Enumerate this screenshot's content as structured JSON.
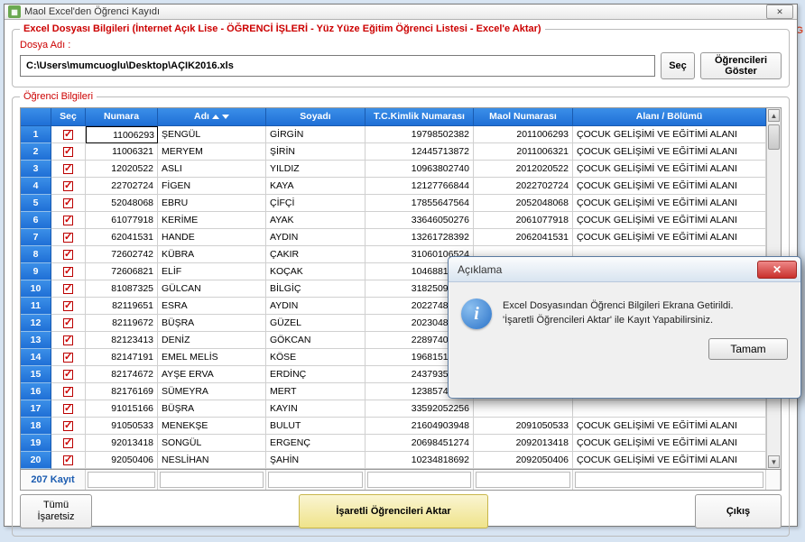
{
  "bg_text": "ESLEKİ EĞİTİM PROG",
  "window": {
    "title": "Maol Excel'den Öğrenci Kayıdı",
    "close_glyph": "✕"
  },
  "fileinfo": {
    "legend": "Excel Dosyası Bilgileri (İnternet Açık Lise - ÖĞRENCİ İŞLERİ - Yüz Yüze Eğitim Öğrenci Listesi - Excel'e Aktar)",
    "file_label": "Dosya Adı :",
    "path": "C:\\Users\\mumcuoglu\\Desktop\\AÇIK2016.xls",
    "sec_label": "Seç",
    "show_label": "Öğrencileri Göster"
  },
  "gridinfo": {
    "legend": "Öğrenci Bilgileri",
    "count_label": "207 Kayıt"
  },
  "columns": {
    "sec": "Seç",
    "numara": "Numara",
    "adi": "Adı",
    "soyadi": "Soyadı",
    "tc": "T.C.Kimlik Numarası",
    "maol": "Maol Numarası",
    "alan": "Alanı / Bölümü"
  },
  "rows": [
    {
      "idx": "1",
      "numara": "11006293",
      "adi": "ŞENGÜL",
      "soyadi": "GİRGİN",
      "tc": "19798502382",
      "maol": "2011006293",
      "alan": "ÇOCUK GELİŞİMİ VE EĞİTİMİ ALANI"
    },
    {
      "idx": "2",
      "numara": "11006321",
      "adi": "MERYEM",
      "soyadi": "ŞİRİN",
      "tc": "12445713872",
      "maol": "2011006321",
      "alan": "ÇOCUK GELİŞİMİ VE EĞİTİMİ ALANI"
    },
    {
      "idx": "3",
      "numara": "12020522",
      "adi": "ASLI",
      "soyadi": "YILDIZ",
      "tc": "10963802740",
      "maol": "2012020522",
      "alan": "ÇOCUK GELİŞİMİ VE EĞİTİMİ ALANI"
    },
    {
      "idx": "4",
      "numara": "22702724",
      "adi": "FİGEN",
      "soyadi": "KAYA",
      "tc": "12127766844",
      "maol": "2022702724",
      "alan": "ÇOCUK GELİŞİMİ VE EĞİTİMİ ALANI"
    },
    {
      "idx": "5",
      "numara": "52048068",
      "adi": "EBRU",
      "soyadi": "ÇİFÇİ",
      "tc": "17855647564",
      "maol": "2052048068",
      "alan": "ÇOCUK GELİŞİMİ VE EĞİTİMİ ALANI"
    },
    {
      "idx": "6",
      "numara": "61077918",
      "adi": "KERİME",
      "soyadi": "AYAK",
      "tc": "33646050276",
      "maol": "2061077918",
      "alan": "ÇOCUK GELİŞİMİ VE EĞİTİMİ ALANI"
    },
    {
      "idx": "7",
      "numara": "62041531",
      "adi": "HANDE",
      "soyadi": "AYDIN",
      "tc": "13261728392",
      "maol": "2062041531",
      "alan": "ÇOCUK GELİŞİMİ VE EĞİTİMİ ALANI"
    },
    {
      "idx": "8",
      "numara": "72602742",
      "adi": "KÜBRA",
      "soyadi": "ÇAKIR",
      "tc": "31060106524",
      "maol": "",
      "alan": ""
    },
    {
      "idx": "9",
      "numara": "72606821",
      "adi": "ELİF",
      "soyadi": "KOÇAK",
      "tc": "10468810806",
      "maol": "",
      "alan": ""
    },
    {
      "idx": "10",
      "numara": "81087325",
      "adi": "GÜLCAN",
      "soyadi": "BİLGİÇ",
      "tc": "31825096688",
      "maol": "",
      "alan": ""
    },
    {
      "idx": "11",
      "numara": "82119651",
      "adi": "ESRA",
      "soyadi": "AYDIN",
      "tc": "20227485268",
      "maol": "",
      "alan": ""
    },
    {
      "idx": "12",
      "numara": "82119672",
      "adi": "BÜŞRA",
      "soyadi": "GÜZEL",
      "tc": "20230485194",
      "maol": "",
      "alan": ""
    },
    {
      "idx": "13",
      "numara": "82123413",
      "adi": "DENİZ",
      "soyadi": "GÖKCAN",
      "tc": "22897405928",
      "maol": "",
      "alan": ""
    },
    {
      "idx": "14",
      "numara": "82147191",
      "adi": "EMEL MELİS",
      "soyadi": "KÖSE",
      "tc": "19681516298",
      "maol": "",
      "alan": ""
    },
    {
      "idx": "15",
      "numara": "82174672",
      "adi": "AYŞE ERVA",
      "soyadi": "ERDİNÇ",
      "tc": "24379356582",
      "maol": "",
      "alan": ""
    },
    {
      "idx": "16",
      "numara": "82176169",
      "adi": "SÜMEYRA",
      "soyadi": "MERT",
      "tc": "12385749986",
      "maol": "",
      "alan": ""
    },
    {
      "idx": "17",
      "numara": "91015166",
      "adi": "BÜŞRA",
      "soyadi": "KAYIN",
      "tc": "33592052256",
      "maol": "",
      "alan": ""
    },
    {
      "idx": "18",
      "numara": "91050533",
      "adi": "MENEKŞE",
      "soyadi": "BULUT",
      "tc": "21604903948",
      "maol": "2091050533",
      "alan": "ÇOCUK GELİŞİMİ VE EĞİTİMİ ALANI"
    },
    {
      "idx": "19",
      "numara": "92013418",
      "adi": "SONGÜL",
      "soyadi": "ERGENÇ",
      "tc": "20698451274",
      "maol": "2092013418",
      "alan": "ÇOCUK GELİŞİMİ VE EĞİTİMİ ALANI"
    },
    {
      "idx": "20",
      "numara": "92050406",
      "adi": "NESLİHAN",
      "soyadi": "ŞAHİN",
      "tc": "10234818692",
      "maol": "2092050406",
      "alan": "ÇOCUK GELİŞİMİ VE EĞİTİMİ ALANI"
    }
  ],
  "buttons": {
    "tumu": "Tümü İşaretsiz",
    "aktar": "İşaretli Öğrencileri Aktar",
    "cikis": "Çıkış"
  },
  "dialog": {
    "title": "Açıklama",
    "line1": "Excel Dosyasından Öğrenci Bilgileri Ekrana Getirildi.",
    "line2": "'İşaretli Öğrencileri Aktar' ile Kayıt Yapabilirsiniz.",
    "ok": "Tamam"
  }
}
